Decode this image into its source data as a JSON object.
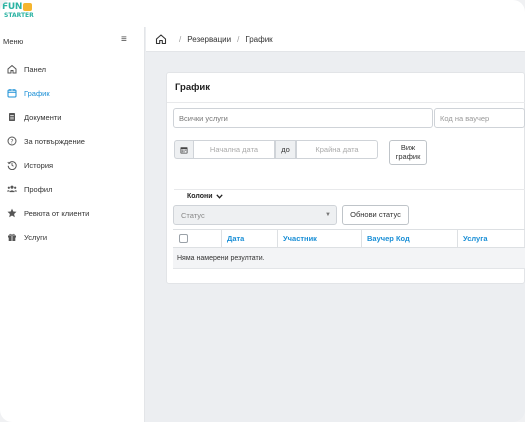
{
  "brand": {
    "line1": "FUN",
    "line2": "STARTER",
    "badge_color": "#f5b52e",
    "color": "#2bb3a3"
  },
  "sidebar": {
    "title": "Меню",
    "items": [
      {
        "label": "Панел",
        "icon": "home-icon",
        "active": false
      },
      {
        "label": "График",
        "icon": "calendar-icon",
        "active": true
      },
      {
        "label": "Документи",
        "icon": "document-icon",
        "active": false
      },
      {
        "label": "За потвърждение",
        "icon": "question-circle-icon",
        "active": false
      },
      {
        "label": "История",
        "icon": "history-icon",
        "active": false
      },
      {
        "label": "Профил",
        "icon": "users-icon",
        "active": false
      },
      {
        "label": "Ревюта от клиенти",
        "icon": "star-icon",
        "active": false
      },
      {
        "label": "Услуги",
        "icon": "gift-icon",
        "active": false
      }
    ]
  },
  "breadcrumb": {
    "items": [
      "Резервации",
      "График"
    ]
  },
  "card": {
    "title": "График",
    "services_placeholder": "Всички услуги",
    "voucher_placeholder": "Код на ваучер",
    "start_date_placeholder": "Начална дата",
    "to_label": "до",
    "end_date_placeholder": "Крайна дата",
    "view_schedule_line1": "Виж",
    "view_schedule_line2": "график",
    "columns_label": "Колони",
    "status_placeholder": "Статус",
    "update_status_label": "Обнови статус"
  },
  "table": {
    "headers": [
      "Дата",
      "Участник",
      "Ваучер Код",
      "Услуга"
    ],
    "empty_message": "Няма намерени резултати."
  },
  "colors": {
    "accent": "#1a8fd6"
  }
}
